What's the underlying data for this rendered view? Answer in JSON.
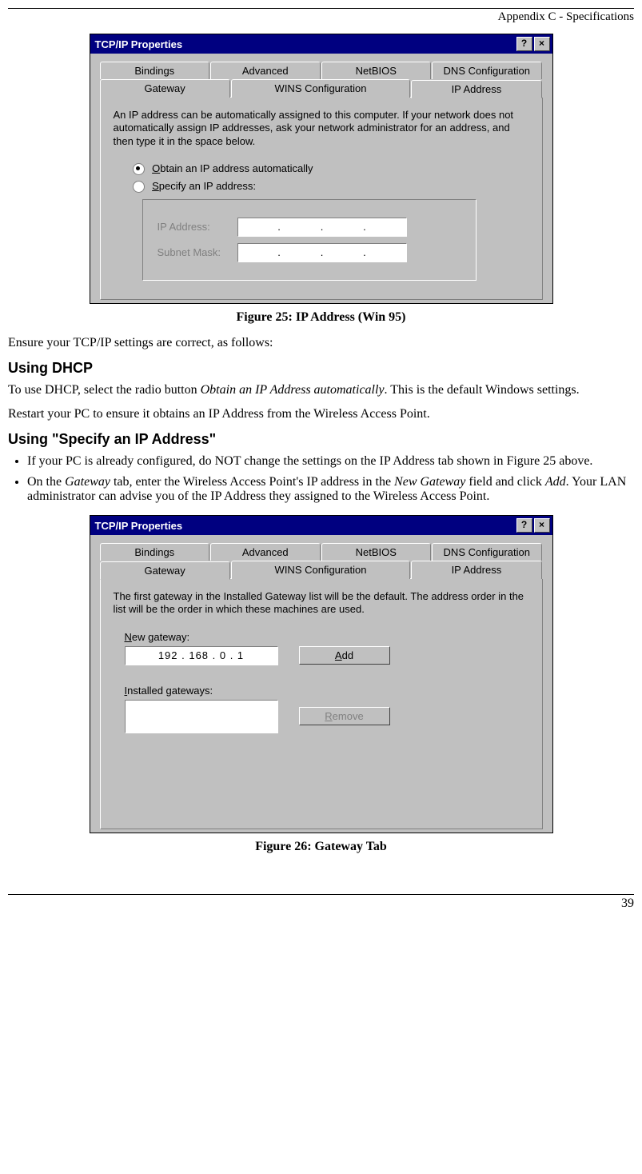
{
  "header": {
    "section": "Appendix C - Specifications"
  },
  "fig25": {
    "title": "TCP/IP Properties",
    "tabs_row1": [
      "Bindings",
      "Advanced",
      "NetBIOS",
      "DNS Configuration"
    ],
    "tabs_row2": [
      "Gateway",
      "WINS Configuration",
      "IP Address"
    ],
    "help": "An IP address can be automatically assigned to this computer. If your network does not automatically assign IP addresses, ask your network administrator for an address, and then type it in the space below.",
    "radio1_pre": "O",
    "radio1": "btain an IP address automatically",
    "radio2_pre": "S",
    "radio2": "pecify an IP address:",
    "ip_label": "IP Address:",
    "mask_label": "Subnet Mask:",
    "caption": "Figure 25:  IP Address (Win 95)"
  },
  "text": {
    "p1": "Ensure your TCP/IP settings are correct, as follows:",
    "h1": "Using DHCP",
    "p2a": "To use DHCP, select the radio button ",
    "p2i": "Obtain an IP Address automatically",
    "p2b": ". This is the default Windows settings.",
    "p3": "Restart your PC to ensure it obtains an IP Address from the Wireless Access Point.",
    "h2": "Using \"Specify an IP Address\"",
    "li1": "If your PC is already configured, do NOT change the settings on the IP Address tab shown in Figure 25 above.",
    "li2a": "On the ",
    "li2i1": "Gateway",
    "li2b": " tab, enter the Wireless Access Point's IP address in the ",
    "li2i2": "New Gateway",
    "li2c": " field and click ",
    "li2i3": "Add",
    "li2d": ". Your LAN administrator can advise you of the IP Address they assigned to the Wireless Access Point."
  },
  "fig26": {
    "title": "TCP/IP Properties",
    "tabs_row1": [
      "Bindings",
      "Advanced",
      "NetBIOS",
      "DNS Configuration"
    ],
    "tabs_row2": [
      "Gateway",
      "WINS Configuration",
      "IP Address"
    ],
    "help": "The first gateway in the Installed Gateway list will be the default. The address order in the list will be the order in which these machines are used.",
    "new_gw_pre": "N",
    "new_gw": "ew gateway:",
    "ip_value": "192 . 168 .   0  .   1",
    "add_pre": "A",
    "add": "dd",
    "installed_pre": "I",
    "installed": "nstalled gateways:",
    "remove_pre": "R",
    "remove": "emove",
    "caption": "Figure 26: Gateway Tab"
  },
  "footer": {
    "page": "39"
  }
}
